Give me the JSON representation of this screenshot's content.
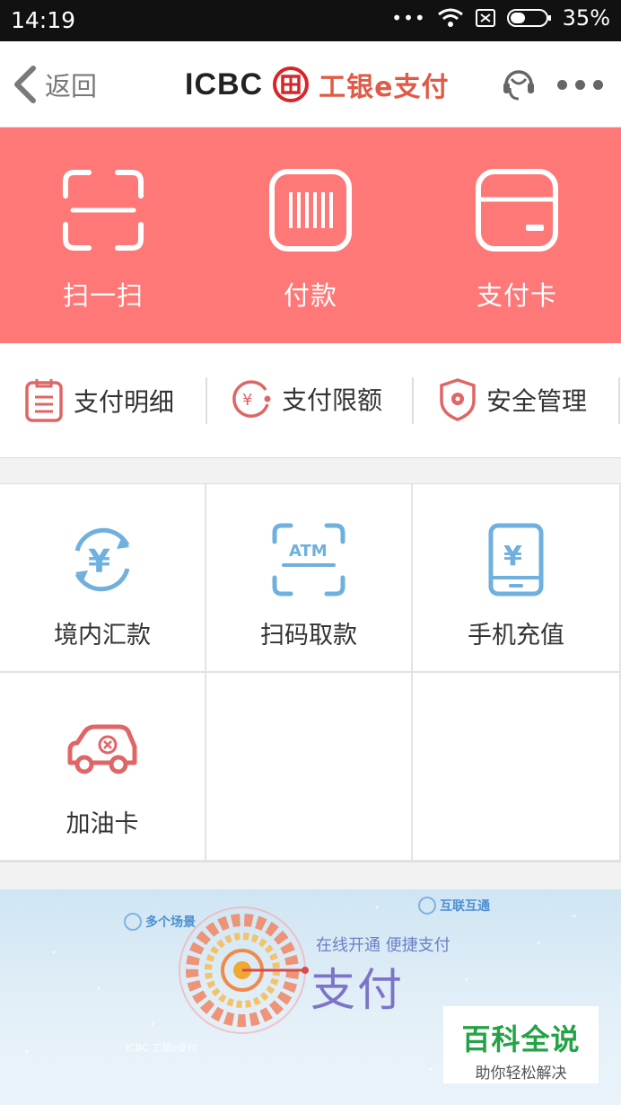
{
  "status_bar": {
    "time": "14:19",
    "battery": "35%"
  },
  "nav": {
    "back_label": "返回",
    "brand_logo_text": "ICBC",
    "brand_pay_text": "工银e支付"
  },
  "hero": {
    "items": [
      {
        "label": "扫一扫",
        "icon": "scan-icon"
      },
      {
        "label": "付款",
        "icon": "barcode-icon"
      },
      {
        "label": "支付卡",
        "icon": "card-icon"
      }
    ]
  },
  "quick_links": [
    {
      "label": "支付明细",
      "icon": "receipt-icon"
    },
    {
      "label": "支付限额",
      "icon": "limit-icon"
    },
    {
      "label": "安全管理",
      "icon": "shield-icon"
    }
  ],
  "services": [
    {
      "label": "境内汇款",
      "icon": "yuan-transfer-icon"
    },
    {
      "label": "扫码取款",
      "icon": "atm-scan-icon"
    },
    {
      "label": "手机充值",
      "icon": "phone-topup-icon"
    },
    {
      "label": "加油卡",
      "icon": "car-icon"
    }
  ],
  "banner": {
    "tag_left": "多个场景",
    "tag_right": "互联互通",
    "slogan": "在线开通 便捷支付",
    "title": "支付",
    "brand_small": "ICBC 工银e支付"
  },
  "watermark": {
    "title": "百科全说",
    "subtitle": "助你轻松解决"
  },
  "colors": {
    "hero_bg": "#fe7878",
    "accent_red": "#e05a46",
    "icon_blue": "#6fb0de",
    "icon_red": "#e06060"
  }
}
